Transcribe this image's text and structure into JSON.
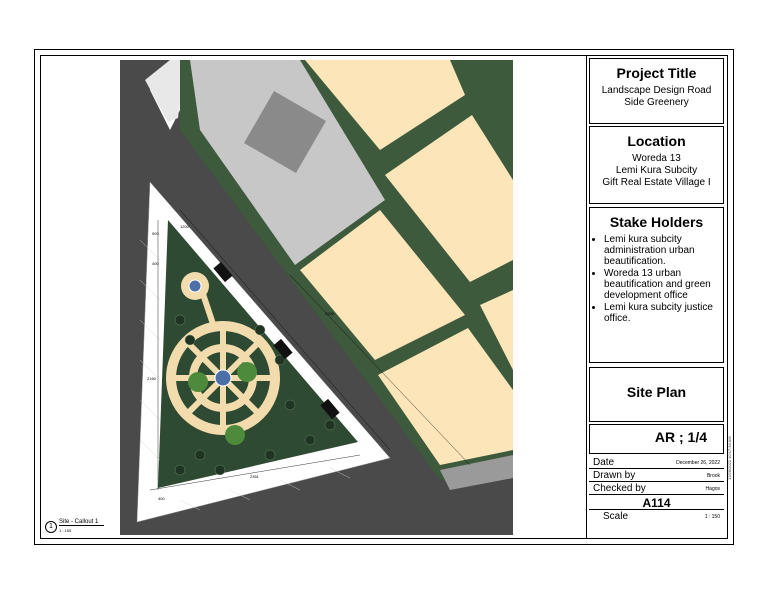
{
  "title_block": {
    "project_title_heading": "Project Title",
    "project_title_line1": "Landscape Design Road",
    "project_title_line2": "Side Greenery",
    "location_heading": "Location",
    "location_line1": "Woreda 13",
    "location_line2": "Lemi Kura Subcity",
    "location_line3": "Gift Real Estate Village I",
    "stakeholders_heading": "Stake Holders",
    "stakeholders": [
      "Lemi kura subcity administration urban beautification.",
      "Woreda 13 urban beautification and green development office",
      "Lemi kura subcity justice office."
    ],
    "drawing_title": "Site Plan",
    "sheet_code": "AR  ; 1/4",
    "date_label": "Date",
    "date_value": "December 26, 2022",
    "drawn_label": "Drawn by",
    "drawn_value": "Brook",
    "checked_label": "Checked by",
    "checked_value": "Hagos",
    "sheet_number": "A114",
    "scale_label": "Scale",
    "scale_value": "1 : 150",
    "stamp": "12/26/2022 10:17:34 AM"
  },
  "callout": {
    "number": "1",
    "name": "Site - Callout 1",
    "scale": "1 : 150"
  },
  "plan_dims": {
    "d1": "400",
    "d2": "2351",
    "d3": "2200",
    "d4": "2160",
    "d5": "900",
    "d6": "400",
    "d7": "1200"
  },
  "colors": {
    "road": "#4a4a4a",
    "plot": "#fce5b8",
    "green_strip": "#3d5a3d",
    "building": "#c4c4c4",
    "garden": "#2f4a32",
    "path": "#f2dcae"
  }
}
